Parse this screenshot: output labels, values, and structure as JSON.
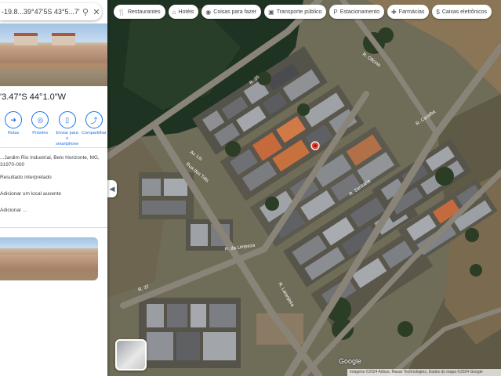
{
  "search": {
    "value": "-19.8...39°47'5S 43°5...7\"W"
  },
  "place": {
    "coords": "'3.47\"S 44°1.0\"W",
    "actions": [
      {
        "label": "Rotas",
        "icon": "directions-icon"
      },
      {
        "label": "Próximo",
        "icon": "nearby-icon"
      },
      {
        "label": "Enviar para o smartphone",
        "icon": "send-to-phone-icon"
      },
      {
        "label": "Compartilhar",
        "icon": "share-icon"
      }
    ],
    "info": [
      {
        "text": "...Jardim Rio Industrial, Belo Horizonte, MG, 31970-000",
        "icon": "pin-icon"
      },
      {
        "text": "Resultado interpretado",
        "icon": "info-icon"
      },
      {
        "text": "Adicionar um local ausente",
        "icon": "add-place-icon"
      },
      {
        "text": "Adicionar ...",
        "icon": "label-icon"
      }
    ]
  },
  "chips": [
    {
      "label": "Restaurantes",
      "icon": "restaurant-icon"
    },
    {
      "label": "Hotéis",
      "icon": "hotel-icon"
    },
    {
      "label": "Coisas para fazer",
      "icon": "camera-icon"
    },
    {
      "label": "Transporte público",
      "icon": "transit-icon"
    },
    {
      "label": "Estacionamento",
      "icon": "parking-icon"
    },
    {
      "label": "Farmácias",
      "icon": "pharmacy-icon"
    },
    {
      "label": "Caixas eletrônicos",
      "icon": "atm-icon"
    }
  ],
  "map": {
    "streets": [
      {
        "id": "s1",
        "label": "R. 26"
      },
      {
        "id": "s2",
        "label": "R. Oficina"
      },
      {
        "id": "s3",
        "label": "R. Caraíba"
      },
      {
        "id": "s4",
        "label": "Rua dos Três"
      },
      {
        "id": "s5",
        "label": "Av. Lis"
      },
      {
        "id": "s6",
        "label": "R. da Limpeza"
      },
      {
        "id": "s7",
        "label": "R. Laranjeira"
      },
      {
        "id": "s8",
        "label": "R. 37"
      },
      {
        "id": "s9",
        "label": "R. Sanitária"
      }
    ],
    "pin_color": "#ea4335",
    "google_logo": "Google",
    "attribution": "Imagens ©2024 Airbus, Maxar Technologies, Dados do mapa ©2024 Google"
  },
  "colors": {
    "accent": "#1a73e8"
  }
}
